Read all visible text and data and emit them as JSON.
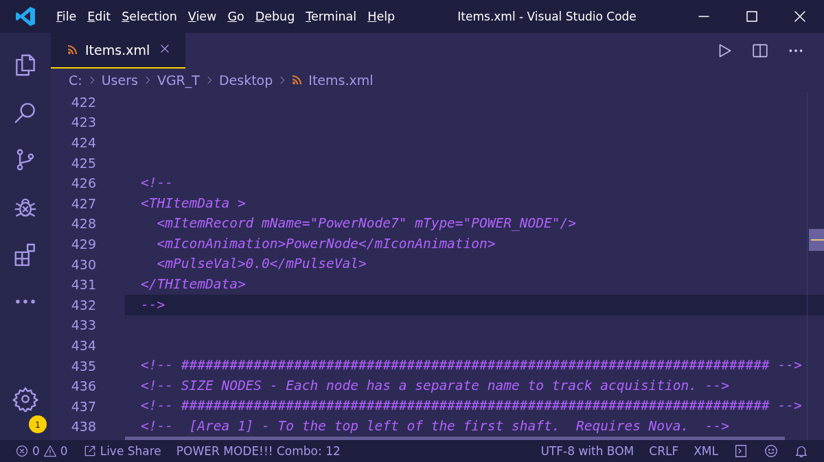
{
  "window": {
    "title": "Items.xml - Visual Studio Code"
  },
  "menu": [
    {
      "label": "File"
    },
    {
      "label": "Edit"
    },
    {
      "label": "Selection"
    },
    {
      "label": "View"
    },
    {
      "label": "Go"
    },
    {
      "label": "Debug"
    },
    {
      "label": "Terminal"
    },
    {
      "label": "Help"
    }
  ],
  "activity_bar": {
    "settings_badge": "1"
  },
  "tabs": [
    {
      "label": "Items.xml",
      "selected": true
    }
  ],
  "breadcrumb": [
    {
      "label": "C:"
    },
    {
      "label": "Users"
    },
    {
      "label": "VGR_T"
    },
    {
      "label": "Desktop"
    },
    {
      "label": "Items.xml",
      "kind": "file"
    }
  ],
  "editor": {
    "lines": [
      {
        "number": "422",
        "current": false
      },
      {
        "number": "423",
        "current": false
      },
      {
        "number": "424",
        "current": false
      },
      {
        "number": "425",
        "current": false
      },
      {
        "number": "426",
        "text": "<!--",
        "current": false
      },
      {
        "number": "427",
        "text": "<THItemData >",
        "current": false
      },
      {
        "number": "428",
        "text": "  <mItemRecord mName=\"PowerNode7\" mType=\"POWER_NODE\"/>",
        "current": false
      },
      {
        "number": "429",
        "text": "  <mIconAnimation>PowerNode</mIconAnimation>",
        "current": false
      },
      {
        "number": "430",
        "text": "  <mPulseVal>0.0</mPulseVal>",
        "current": false
      },
      {
        "number": "431",
        "text": "</THItemData>",
        "current": false
      },
      {
        "number": "432",
        "text": "-->",
        "current": true
      },
      {
        "number": "433",
        "current": false
      },
      {
        "number": "434",
        "current": false
      },
      {
        "number": "435",
        "text": "<!-- ######################################################################### -->",
        "current": false
      },
      {
        "number": "436",
        "text": "<!-- SIZE NODES - Each node has a separate name to track acquisition. -->",
        "current": false
      },
      {
        "number": "437",
        "text": "<!-- ######################################################################### -->",
        "current": false
      },
      {
        "number": "438",
        "text": "<!--  [Area 1] - To the top left of the first shaft.  Requires Nova.  -->",
        "current": false
      }
    ]
  },
  "status_bar": {
    "errors": "0",
    "warnings": "0",
    "live_share": "Live Share",
    "power_mode": "POWER MODE!!! Combo: 12",
    "encoding": "UTF-8 with BOM",
    "line_ending": "CRLF",
    "language": "XML"
  }
}
